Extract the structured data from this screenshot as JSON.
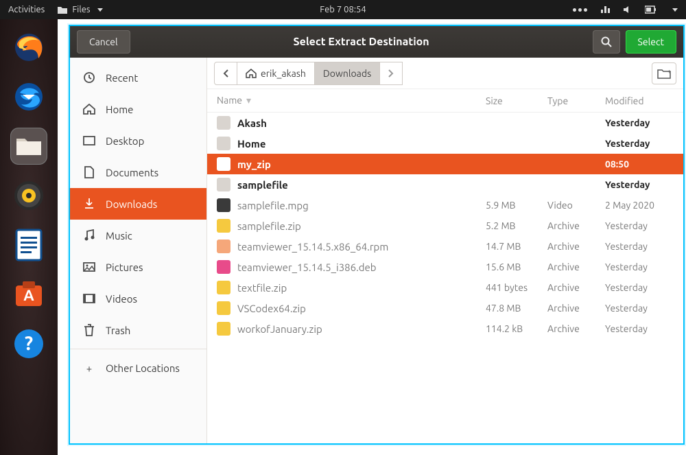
{
  "top_panel": {
    "activities": "Activities",
    "app_menu": "Files",
    "clock": "Feb 7  08:54"
  },
  "dialog": {
    "title": "Select Extract Destination",
    "cancel": "Cancel",
    "select": "Select"
  },
  "places": [
    {
      "icon": "clock-icon",
      "label": "Recent"
    },
    {
      "icon": "home-icon",
      "label": "Home"
    },
    {
      "icon": "desktop-icon",
      "label": "Desktop"
    },
    {
      "icon": "doc-icon",
      "label": "Documents"
    },
    {
      "icon": "download-icon",
      "label": "Downloads",
      "active": true
    },
    {
      "icon": "music-icon",
      "label": "Music"
    },
    {
      "icon": "picture-icon",
      "label": "Pictures"
    },
    {
      "icon": "video-icon",
      "label": "Videos"
    },
    {
      "icon": "trash-icon",
      "label": "Trash"
    }
  ],
  "places_other": "Other Locations",
  "breadcrumb": {
    "home": "erik_akash",
    "current": "Downloads"
  },
  "columns": {
    "name": "Name",
    "size": "Size",
    "type": "Type",
    "modified": "Modified"
  },
  "rows": [
    {
      "kind": "folder",
      "icon": "icon-folder",
      "name": "Akash",
      "size": "",
      "type": "",
      "modified": "Yesterday"
    },
    {
      "kind": "folder",
      "icon": "icon-folder",
      "name": "Home",
      "size": "",
      "type": "",
      "modified": "Yesterday"
    },
    {
      "kind": "folder",
      "icon": "icon-folder",
      "name": "my_zip",
      "size": "",
      "type": "",
      "modified": "08:50",
      "selected": true
    },
    {
      "kind": "folder",
      "icon": "icon-folder",
      "name": "samplefile",
      "size": "",
      "type": "",
      "modified": "Yesterday"
    },
    {
      "kind": "file",
      "icon": "icon-vid",
      "name": "samplefile.mpg",
      "size": "5.9 MB",
      "type": "Video",
      "modified": "2 May 2020"
    },
    {
      "kind": "file",
      "icon": "icon-zip",
      "name": "samplefile.zip",
      "size": "5.2 MB",
      "type": "Archive",
      "modified": "Yesterday"
    },
    {
      "kind": "file",
      "icon": "icon-rpm",
      "name": "teamviewer_15.14.5.x86_64.rpm",
      "size": "14.7 MB",
      "type": "Archive",
      "modified": "Yesterday"
    },
    {
      "kind": "file",
      "icon": "icon-deb",
      "name": "teamviewer_15.14.5_i386.deb",
      "size": "15.6 MB",
      "type": "Archive",
      "modified": "Yesterday"
    },
    {
      "kind": "file",
      "icon": "icon-zip",
      "name": "textfile.zip",
      "size": "441 bytes",
      "type": "Archive",
      "modified": "Yesterday"
    },
    {
      "kind": "file",
      "icon": "icon-zip",
      "name": "VSCodex64.zip",
      "size": "47.8 MB",
      "type": "Archive",
      "modified": "Yesterday"
    },
    {
      "kind": "file",
      "icon": "icon-zip",
      "name": "workofJanuary.zip",
      "size": "114.2 kB",
      "type": "Archive",
      "modified": "Yesterday"
    }
  ]
}
